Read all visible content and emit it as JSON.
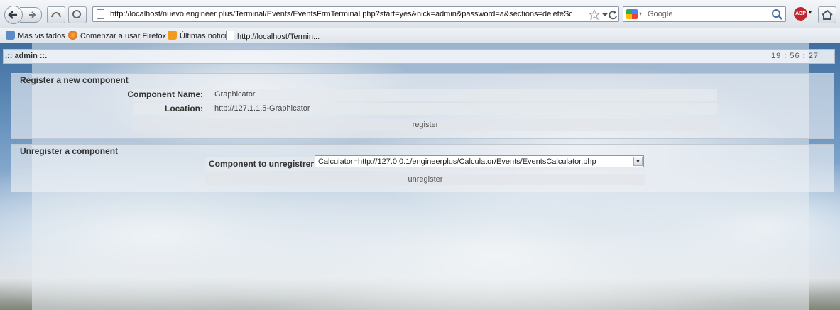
{
  "browser": {
    "url": "http://localhost/nuevo engineer plus/Terminal/Events/EventsFrmTerminal.php?start=yes&nick=admin&password=a&sections=deleteScriptJS_unRegiste",
    "search_engine": "Google",
    "bookmarks": [
      {
        "label": "Más visitados",
        "icon": "most-visited-icon"
      },
      {
        "label": "Comenzar a usar Firefox",
        "icon": "firefox-icon"
      },
      {
        "label": "Últimas noticias",
        "icon": "rss-icon"
      },
      {
        "label": "http://localhost/Termin...",
        "icon": "page-icon"
      }
    ]
  },
  "header": {
    "user": ".:: admin ::.",
    "time": "19 : 56 : 27"
  },
  "register": {
    "title": "Register a new component",
    "name_label": "Component Name:",
    "name_value": "Graphicator",
    "location_label": "Location:",
    "location_value": "http://127.1.1.5-Graphicator",
    "button": "register"
  },
  "unregister": {
    "title": "Unregister a component",
    "label": "Component to unregistrer",
    "selected": "Calculator=http://127.0.0.1/engineerplus/Calculator/Events/EventsCalculator.php",
    "button": "unregister"
  }
}
